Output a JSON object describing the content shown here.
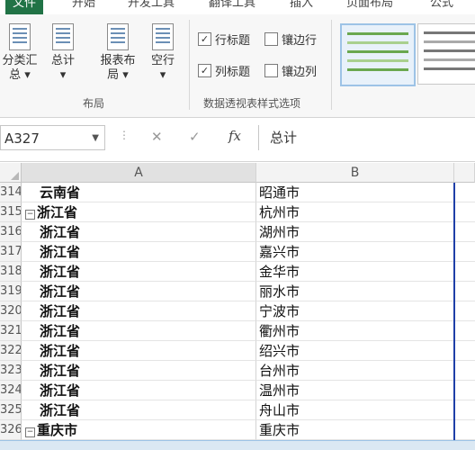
{
  "tabs": [
    "文件",
    "开始",
    "开发工具",
    "翻译工具",
    "插入",
    "页面布局",
    "公式"
  ],
  "ribbon": {
    "buttons": [
      {
        "label": "分类汇总",
        "line1": "分类汇",
        "line2": "总 ▾"
      },
      {
        "label": "总计",
        "line1": "总计",
        "line2": "▾"
      },
      {
        "label": "报表布局",
        "line1": "报表布",
        "line2": "局 ▾"
      },
      {
        "label": "空行",
        "line1": "空行",
        "line2": "▾"
      }
    ],
    "group_layout": "布局",
    "checkboxes": {
      "row_headers": {
        "label": "行标题",
        "checked": true
      },
      "banded_rows": {
        "label": "镶边行",
        "checked": false
      },
      "col_headers": {
        "label": "列标题",
        "checked": true
      },
      "banded_cols": {
        "label": "镶边列",
        "checked": false
      }
    },
    "group_style_options": "数据透视表样式选项"
  },
  "formula_bar": {
    "name_box": "A327",
    "formula": "总计"
  },
  "columns": [
    "A",
    "B"
  ],
  "rows": [
    {
      "num": "314",
      "a": "云南省",
      "b": "昭通市",
      "collapse": false
    },
    {
      "num": "315",
      "a": "浙江省",
      "b": "杭州市",
      "collapse": true
    },
    {
      "num": "316",
      "a": "浙江省",
      "b": "湖州市",
      "collapse": false
    },
    {
      "num": "317",
      "a": "浙江省",
      "b": "嘉兴市",
      "collapse": false
    },
    {
      "num": "318",
      "a": "浙江省",
      "b": "金华市",
      "collapse": false
    },
    {
      "num": "319",
      "a": "浙江省",
      "b": "丽水市",
      "collapse": false
    },
    {
      "num": "320",
      "a": "浙江省",
      "b": "宁波市",
      "collapse": false
    },
    {
      "num": "321",
      "a": "浙江省",
      "b": "衢州市",
      "collapse": false
    },
    {
      "num": "322",
      "a": "浙江省",
      "b": "绍兴市",
      "collapse": false
    },
    {
      "num": "323",
      "a": "浙江省",
      "b": "台州市",
      "collapse": false
    },
    {
      "num": "324",
      "a": "浙江省",
      "b": "温州市",
      "collapse": false
    },
    {
      "num": "325",
      "a": "浙江省",
      "b": "舟山市",
      "collapse": false
    },
    {
      "num": "326",
      "a": "重庆市",
      "b": "重庆市",
      "collapse": true
    }
  ],
  "colors": {
    "accent": "#217346",
    "selection_border": "#1f3fa8"
  }
}
